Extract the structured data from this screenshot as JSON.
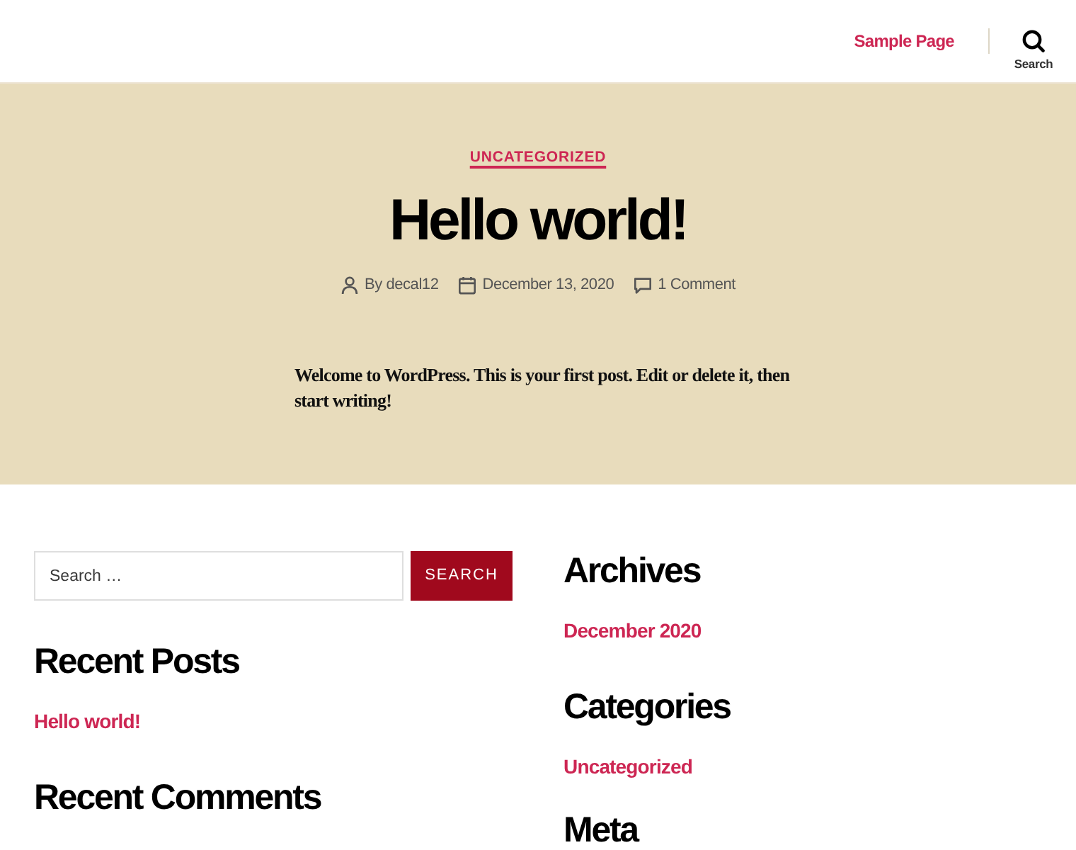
{
  "header": {
    "nav": [
      {
        "label": "Sample Page"
      }
    ],
    "search_toggle": {
      "label": "Search"
    }
  },
  "post": {
    "category": "UNCATEGORIZED",
    "title": "Hello world!",
    "meta": [
      {
        "kind": "author",
        "text": "By decal12"
      },
      {
        "kind": "date",
        "text": "December 13, 2020"
      },
      {
        "kind": "comments",
        "text": "1 Comment"
      }
    ],
    "content": "Welcome to WordPress. This is your first post. Edit or delete it, then start writing!"
  },
  "sidebar_left": {
    "search": {
      "placeholder": "Search …",
      "button": "SEARCH"
    },
    "widgets": [
      {
        "title": "Recent Posts",
        "links": [
          "Hello world!"
        ]
      },
      {
        "title": "Recent Comments"
      }
    ]
  },
  "sidebar_right": {
    "widgets": [
      {
        "title": "Archives",
        "links": [
          "December 2020"
        ]
      },
      {
        "title": "Categories",
        "links": [
          "Uncategorized"
        ]
      },
      {
        "title": "Meta"
      }
    ]
  }
}
